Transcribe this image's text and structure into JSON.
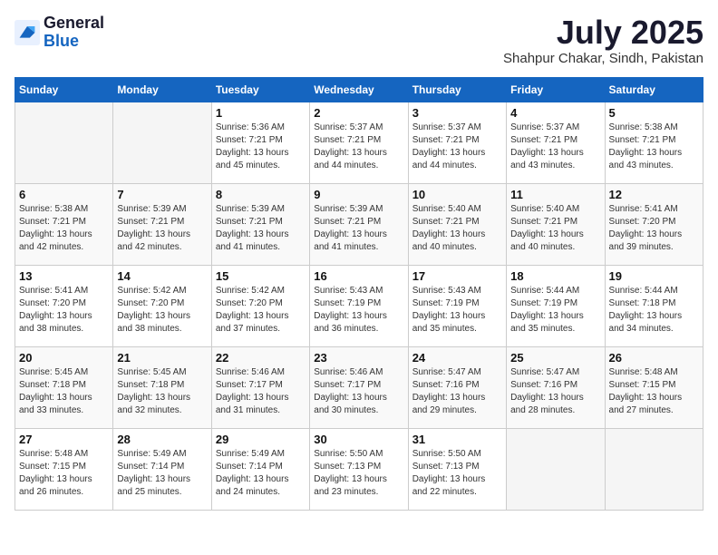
{
  "logo": {
    "line1": "General",
    "line2": "Blue"
  },
  "title": "July 2025",
  "subtitle": "Shahpur Chakar, Sindh, Pakistan",
  "headers": [
    "Sunday",
    "Monday",
    "Tuesday",
    "Wednesday",
    "Thursday",
    "Friday",
    "Saturday"
  ],
  "weeks": [
    [
      {
        "day": "",
        "info": ""
      },
      {
        "day": "",
        "info": ""
      },
      {
        "day": "1",
        "info": "Sunrise: 5:36 AM\nSunset: 7:21 PM\nDaylight: 13 hours\nand 45 minutes."
      },
      {
        "day": "2",
        "info": "Sunrise: 5:37 AM\nSunset: 7:21 PM\nDaylight: 13 hours\nand 44 minutes."
      },
      {
        "day": "3",
        "info": "Sunrise: 5:37 AM\nSunset: 7:21 PM\nDaylight: 13 hours\nand 44 minutes."
      },
      {
        "day": "4",
        "info": "Sunrise: 5:37 AM\nSunset: 7:21 PM\nDaylight: 13 hours\nand 43 minutes."
      },
      {
        "day": "5",
        "info": "Sunrise: 5:38 AM\nSunset: 7:21 PM\nDaylight: 13 hours\nand 43 minutes."
      }
    ],
    [
      {
        "day": "6",
        "info": "Sunrise: 5:38 AM\nSunset: 7:21 PM\nDaylight: 13 hours\nand 42 minutes."
      },
      {
        "day": "7",
        "info": "Sunrise: 5:39 AM\nSunset: 7:21 PM\nDaylight: 13 hours\nand 42 minutes."
      },
      {
        "day": "8",
        "info": "Sunrise: 5:39 AM\nSunset: 7:21 PM\nDaylight: 13 hours\nand 41 minutes."
      },
      {
        "day": "9",
        "info": "Sunrise: 5:39 AM\nSunset: 7:21 PM\nDaylight: 13 hours\nand 41 minutes."
      },
      {
        "day": "10",
        "info": "Sunrise: 5:40 AM\nSunset: 7:21 PM\nDaylight: 13 hours\nand 40 minutes."
      },
      {
        "day": "11",
        "info": "Sunrise: 5:40 AM\nSunset: 7:21 PM\nDaylight: 13 hours\nand 40 minutes."
      },
      {
        "day": "12",
        "info": "Sunrise: 5:41 AM\nSunset: 7:20 PM\nDaylight: 13 hours\nand 39 minutes."
      }
    ],
    [
      {
        "day": "13",
        "info": "Sunrise: 5:41 AM\nSunset: 7:20 PM\nDaylight: 13 hours\nand 38 minutes."
      },
      {
        "day": "14",
        "info": "Sunrise: 5:42 AM\nSunset: 7:20 PM\nDaylight: 13 hours\nand 38 minutes."
      },
      {
        "day": "15",
        "info": "Sunrise: 5:42 AM\nSunset: 7:20 PM\nDaylight: 13 hours\nand 37 minutes."
      },
      {
        "day": "16",
        "info": "Sunrise: 5:43 AM\nSunset: 7:19 PM\nDaylight: 13 hours\nand 36 minutes."
      },
      {
        "day": "17",
        "info": "Sunrise: 5:43 AM\nSunset: 7:19 PM\nDaylight: 13 hours\nand 35 minutes."
      },
      {
        "day": "18",
        "info": "Sunrise: 5:44 AM\nSunset: 7:19 PM\nDaylight: 13 hours\nand 35 minutes."
      },
      {
        "day": "19",
        "info": "Sunrise: 5:44 AM\nSunset: 7:18 PM\nDaylight: 13 hours\nand 34 minutes."
      }
    ],
    [
      {
        "day": "20",
        "info": "Sunrise: 5:45 AM\nSunset: 7:18 PM\nDaylight: 13 hours\nand 33 minutes."
      },
      {
        "day": "21",
        "info": "Sunrise: 5:45 AM\nSunset: 7:18 PM\nDaylight: 13 hours\nand 32 minutes."
      },
      {
        "day": "22",
        "info": "Sunrise: 5:46 AM\nSunset: 7:17 PM\nDaylight: 13 hours\nand 31 minutes."
      },
      {
        "day": "23",
        "info": "Sunrise: 5:46 AM\nSunset: 7:17 PM\nDaylight: 13 hours\nand 30 minutes."
      },
      {
        "day": "24",
        "info": "Sunrise: 5:47 AM\nSunset: 7:16 PM\nDaylight: 13 hours\nand 29 minutes."
      },
      {
        "day": "25",
        "info": "Sunrise: 5:47 AM\nSunset: 7:16 PM\nDaylight: 13 hours\nand 28 minutes."
      },
      {
        "day": "26",
        "info": "Sunrise: 5:48 AM\nSunset: 7:15 PM\nDaylight: 13 hours\nand 27 minutes."
      }
    ],
    [
      {
        "day": "27",
        "info": "Sunrise: 5:48 AM\nSunset: 7:15 PM\nDaylight: 13 hours\nand 26 minutes."
      },
      {
        "day": "28",
        "info": "Sunrise: 5:49 AM\nSunset: 7:14 PM\nDaylight: 13 hours\nand 25 minutes."
      },
      {
        "day": "29",
        "info": "Sunrise: 5:49 AM\nSunset: 7:14 PM\nDaylight: 13 hours\nand 24 minutes."
      },
      {
        "day": "30",
        "info": "Sunrise: 5:50 AM\nSunset: 7:13 PM\nDaylight: 13 hours\nand 23 minutes."
      },
      {
        "day": "31",
        "info": "Sunrise: 5:50 AM\nSunset: 7:13 PM\nDaylight: 13 hours\nand 22 minutes."
      },
      {
        "day": "",
        "info": ""
      },
      {
        "day": "",
        "info": ""
      }
    ]
  ]
}
